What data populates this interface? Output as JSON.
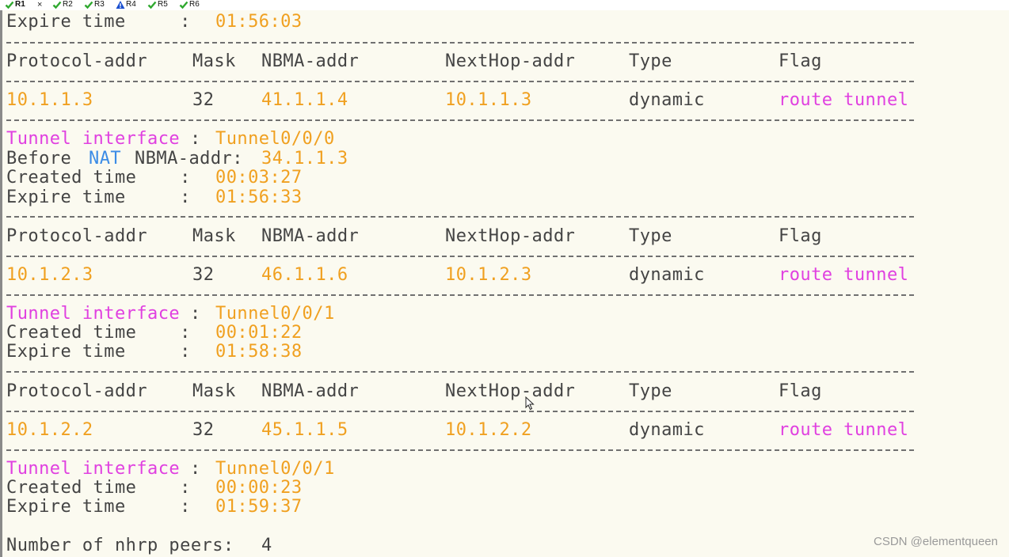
{
  "tabs": [
    {
      "label": "R1",
      "status": "ok",
      "active": true
    },
    {
      "label": "R2",
      "status": "ok",
      "active": false
    },
    {
      "label": "R3",
      "status": "ok",
      "active": false
    },
    {
      "label": "R4",
      "status": "warning",
      "active": false
    },
    {
      "label": "R5",
      "status": "ok",
      "active": false
    },
    {
      "label": "R6",
      "status": "ok",
      "active": false
    }
  ],
  "tab_close_glyph": "×",
  "colors": {
    "ok": "#2fa82f",
    "warning": "#1a4fd0",
    "value_orange": "#f0a020",
    "keyword_magenta": "#e040e0",
    "keyword_blue": "#3c8ce6",
    "plain_gray": "#444444"
  },
  "terminal": {
    "top_expire": {
      "label": "Expire time     :",
      "value": "01:56:03"
    },
    "headers": [
      "Protocol-addr",
      "Mask",
      "NBMA-addr",
      "NextHop-addr",
      "Type",
      "Flag"
    ],
    "blocks": [
      {
        "row": {
          "protocol_addr": "10.1.1.3",
          "mask": "32",
          "nbma_addr": "41.1.1.4",
          "nexthop_addr": "10.1.1.3",
          "type": "dynamic",
          "flag": "route tunnel"
        },
        "tunnel_kw": "Tunnel interface",
        "tunnel_colon": ":",
        "tunnel_value": "Tunnel0/0/0",
        "before_nat": {
          "prefix": "Before",
          "nat": "NAT",
          "rest": "NBMA-addr:",
          "value": "34.1.1.3"
        },
        "created": {
          "label": "Created time    :",
          "value": "00:03:27"
        },
        "expire": {
          "label": "Expire time     :",
          "value": "01:56:33"
        }
      },
      {
        "row": {
          "protocol_addr": "10.1.2.3",
          "mask": "32",
          "nbma_addr": "46.1.1.6",
          "nexthop_addr": "10.1.2.3",
          "type": "dynamic",
          "flag": "route tunnel"
        },
        "tunnel_kw": "Tunnel interface",
        "tunnel_colon": ":",
        "tunnel_value": "Tunnel0/0/1",
        "created": {
          "label": "Created time    :",
          "value": "00:01:22"
        },
        "expire": {
          "label": "Expire time     :",
          "value": "01:58:38"
        }
      },
      {
        "row": {
          "protocol_addr": "10.1.2.2",
          "mask": "32",
          "nbma_addr": "45.1.1.5",
          "nexthop_addr": "10.1.2.2",
          "type": "dynamic",
          "flag": "route tunnel"
        },
        "tunnel_kw": "Tunnel interface",
        "tunnel_colon": ":",
        "tunnel_value": "Tunnel0/0/1",
        "created": {
          "label": "Created time    :",
          "value": "00:00:23"
        },
        "expire": {
          "label": "Expire time     :",
          "value": "01:59:37"
        }
      }
    ],
    "peers": {
      "label": "Number of nhrp peers:",
      "value": "4"
    }
  },
  "watermark": "CSDN @elementqueen"
}
